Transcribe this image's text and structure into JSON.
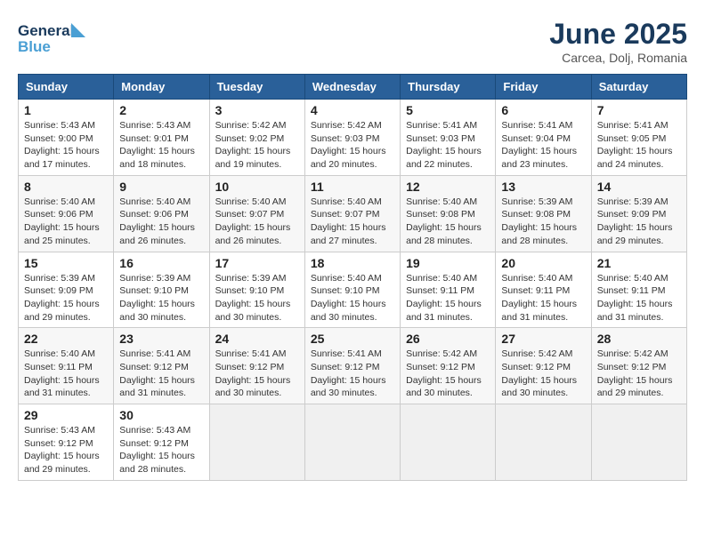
{
  "header": {
    "logo_line1": "General",
    "logo_line2": "Blue",
    "month": "June 2025",
    "location": "Carcea, Dolj, Romania"
  },
  "weekdays": [
    "Sunday",
    "Monday",
    "Tuesday",
    "Wednesday",
    "Thursday",
    "Friday",
    "Saturday"
  ],
  "weeks": [
    [
      {
        "day": "1",
        "sunrise": "5:43 AM",
        "sunset": "9:00 PM",
        "daylight": "15 hours and 17 minutes."
      },
      {
        "day": "2",
        "sunrise": "5:43 AM",
        "sunset": "9:01 PM",
        "daylight": "15 hours and 18 minutes."
      },
      {
        "day": "3",
        "sunrise": "5:42 AM",
        "sunset": "9:02 PM",
        "daylight": "15 hours and 19 minutes."
      },
      {
        "day": "4",
        "sunrise": "5:42 AM",
        "sunset": "9:03 PM",
        "daylight": "15 hours and 20 minutes."
      },
      {
        "day": "5",
        "sunrise": "5:41 AM",
        "sunset": "9:03 PM",
        "daylight": "15 hours and 22 minutes."
      },
      {
        "day": "6",
        "sunrise": "5:41 AM",
        "sunset": "9:04 PM",
        "daylight": "15 hours and 23 minutes."
      },
      {
        "day": "7",
        "sunrise": "5:41 AM",
        "sunset": "9:05 PM",
        "daylight": "15 hours and 24 minutes."
      }
    ],
    [
      {
        "day": "8",
        "sunrise": "5:40 AM",
        "sunset": "9:06 PM",
        "daylight": "15 hours and 25 minutes."
      },
      {
        "day": "9",
        "sunrise": "5:40 AM",
        "sunset": "9:06 PM",
        "daylight": "15 hours and 26 minutes."
      },
      {
        "day": "10",
        "sunrise": "5:40 AM",
        "sunset": "9:07 PM",
        "daylight": "15 hours and 26 minutes."
      },
      {
        "day": "11",
        "sunrise": "5:40 AM",
        "sunset": "9:07 PM",
        "daylight": "15 hours and 27 minutes."
      },
      {
        "day": "12",
        "sunrise": "5:40 AM",
        "sunset": "9:08 PM",
        "daylight": "15 hours and 28 minutes."
      },
      {
        "day": "13",
        "sunrise": "5:39 AM",
        "sunset": "9:08 PM",
        "daylight": "15 hours and 28 minutes."
      },
      {
        "day": "14",
        "sunrise": "5:39 AM",
        "sunset": "9:09 PM",
        "daylight": "15 hours and 29 minutes."
      }
    ],
    [
      {
        "day": "15",
        "sunrise": "5:39 AM",
        "sunset": "9:09 PM",
        "daylight": "15 hours and 29 minutes."
      },
      {
        "day": "16",
        "sunrise": "5:39 AM",
        "sunset": "9:10 PM",
        "daylight": "15 hours and 30 minutes."
      },
      {
        "day": "17",
        "sunrise": "5:39 AM",
        "sunset": "9:10 PM",
        "daylight": "15 hours and 30 minutes."
      },
      {
        "day": "18",
        "sunrise": "5:40 AM",
        "sunset": "9:10 PM",
        "daylight": "15 hours and 30 minutes."
      },
      {
        "day": "19",
        "sunrise": "5:40 AM",
        "sunset": "9:11 PM",
        "daylight": "15 hours and 31 minutes."
      },
      {
        "day": "20",
        "sunrise": "5:40 AM",
        "sunset": "9:11 PM",
        "daylight": "15 hours and 31 minutes."
      },
      {
        "day": "21",
        "sunrise": "5:40 AM",
        "sunset": "9:11 PM",
        "daylight": "15 hours and 31 minutes."
      }
    ],
    [
      {
        "day": "22",
        "sunrise": "5:40 AM",
        "sunset": "9:11 PM",
        "daylight": "15 hours and 31 minutes."
      },
      {
        "day": "23",
        "sunrise": "5:41 AM",
        "sunset": "9:12 PM",
        "daylight": "15 hours and 31 minutes."
      },
      {
        "day": "24",
        "sunrise": "5:41 AM",
        "sunset": "9:12 PM",
        "daylight": "15 hours and 30 minutes."
      },
      {
        "day": "25",
        "sunrise": "5:41 AM",
        "sunset": "9:12 PM",
        "daylight": "15 hours and 30 minutes."
      },
      {
        "day": "26",
        "sunrise": "5:42 AM",
        "sunset": "9:12 PM",
        "daylight": "15 hours and 30 minutes."
      },
      {
        "day": "27",
        "sunrise": "5:42 AM",
        "sunset": "9:12 PM",
        "daylight": "15 hours and 30 minutes."
      },
      {
        "day": "28",
        "sunrise": "5:42 AM",
        "sunset": "9:12 PM",
        "daylight": "15 hours and 29 minutes."
      }
    ],
    [
      {
        "day": "29",
        "sunrise": "5:43 AM",
        "sunset": "9:12 PM",
        "daylight": "15 hours and 29 minutes."
      },
      {
        "day": "30",
        "sunrise": "5:43 AM",
        "sunset": "9:12 PM",
        "daylight": "15 hours and 28 minutes."
      },
      null,
      null,
      null,
      null,
      null
    ]
  ]
}
